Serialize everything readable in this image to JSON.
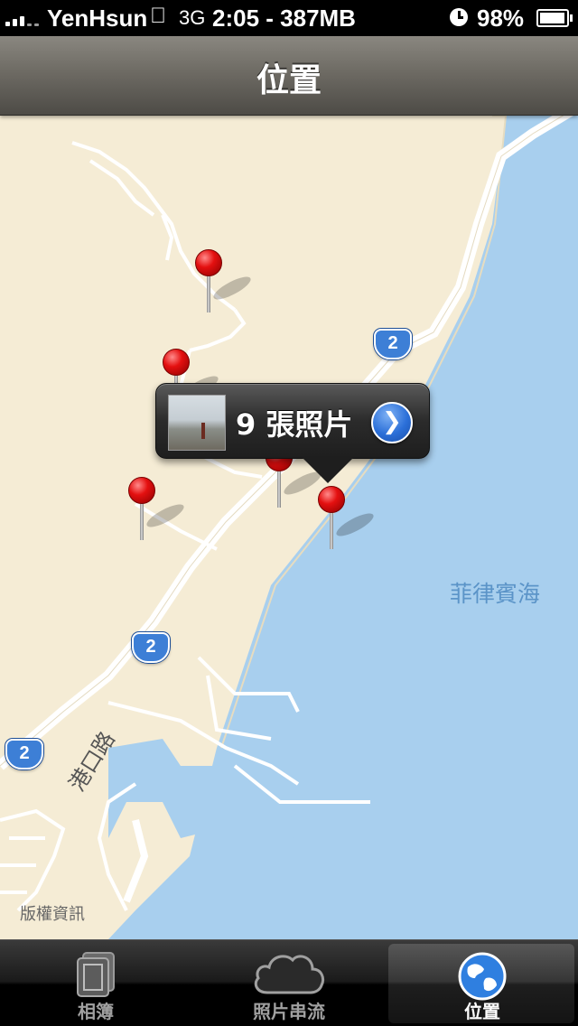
{
  "status_bar": {
    "carrier": "YenHsun",
    "network": "3G",
    "time_memory": "2:05 - 387MB",
    "battery_percent_text": "98%",
    "battery_level": 0.98
  },
  "nav": {
    "title": "位置"
  },
  "map": {
    "sea_label": "菲律賓海",
    "road_label": "港口路",
    "copyright": "版權資訊",
    "highway_shields": [
      "2",
      "2",
      "2"
    ]
  },
  "callout": {
    "label": "9 張照片"
  },
  "tabs": [
    {
      "label": "相簿",
      "icon": "album-icon",
      "active": false
    },
    {
      "label": "照片串流",
      "icon": "cloud-icon",
      "active": false
    },
    {
      "label": "位置",
      "icon": "globe-icon",
      "active": true
    }
  ],
  "colors": {
    "land": "#f5ecd5",
    "sea": "#a8cfee",
    "road": "#ffffff",
    "pin": "#e41010",
    "shield": "#3d7fd6"
  }
}
